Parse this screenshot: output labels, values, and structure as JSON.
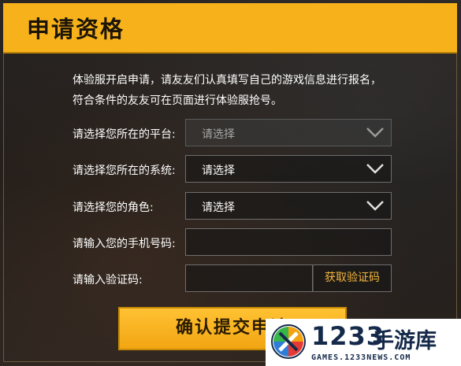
{
  "header": {
    "title": "申请资格"
  },
  "intro": {
    "line1": "体验服开启申请，请友友们认真填写自己的游戏信息进行报名，",
    "line2": "符合条件的友友可在页面进行体验服抢号。"
  },
  "form": {
    "platform": {
      "label": "请选择您所在的平台:",
      "value": "请选择",
      "icon": "chevron-down-icon"
    },
    "system": {
      "label": "请选择您所在的系统:",
      "value": "请选择",
      "icon": "chevron-down-icon"
    },
    "role": {
      "label": "请选择您的角色:",
      "value": "请选择",
      "icon": "chevron-down-icon"
    },
    "phone": {
      "label": "请输入您的手机号码:",
      "value": ""
    },
    "code": {
      "label": "请输入验证码:",
      "value": "",
      "button": "获取验证码"
    }
  },
  "submit": {
    "label": "确认提交申请"
  },
  "watermark": {
    "number": "1233",
    "name": "手游库",
    "url": "GAMES.1233NEWS.COM"
  },
  "colors": {
    "accent": "#f7b21b",
    "code_button_text": "#f4b53a",
    "watermark_text": "#15294a"
  }
}
